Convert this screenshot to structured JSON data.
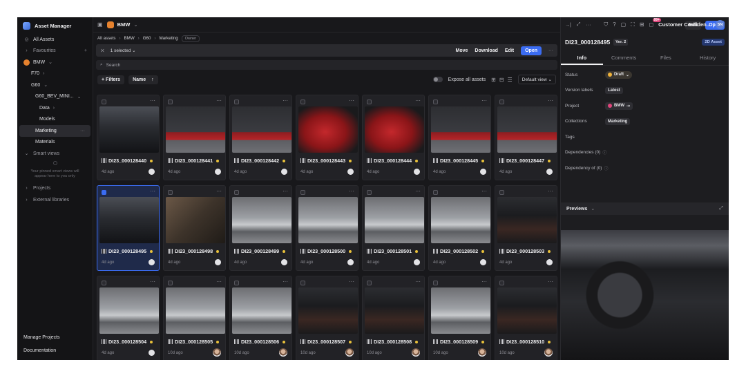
{
  "app": {
    "title": "Asset Manager"
  },
  "sidebar": {
    "items": [
      {
        "label": "All Assets"
      },
      {
        "label": "Favourites"
      },
      {
        "label": "BMW"
      },
      {
        "label": "F70"
      },
      {
        "label": "G60"
      },
      {
        "label": "G60_BEV_MINI..."
      },
      {
        "label": "Data"
      },
      {
        "label": "Models"
      },
      {
        "label": "Marketing"
      },
      {
        "label": "Materials"
      },
      {
        "label": "Smart views"
      },
      {
        "label": "Projects"
      },
      {
        "label": "External libraries"
      }
    ],
    "smart_hint": "Your pinned smart views will appear here to you only",
    "bottom": [
      {
        "label": "Manage Projects"
      },
      {
        "label": "Documentation"
      }
    ]
  },
  "header": {
    "workspace": "BMW",
    "notif_badge": "99+",
    "account": "Customer Confiden...",
    "avatar_initials": "SN"
  },
  "breadcrumb": [
    "All assets",
    "BMW",
    "G60",
    "Marketing"
  ],
  "owner_tag": "Owner",
  "selection": {
    "count": "1 selected",
    "actions": [
      "Move",
      "Download",
      "Edit"
    ],
    "open_label": "Open"
  },
  "search": {
    "placeholder": "Search"
  },
  "toolbar": {
    "filters": "Filters",
    "sort": "Name",
    "expose": "Expose all assets",
    "view": "Default view"
  },
  "assets": [
    {
      "name": "DI23_000128440",
      "age": "4d ago",
      "thumb": "t-int"
    },
    {
      "name": "DI23_000128441",
      "age": "4d ago",
      "thumb": "t-red"
    },
    {
      "name": "DI23_000128442",
      "age": "4d ago",
      "thumb": "t-red"
    },
    {
      "name": "DI23_000128443",
      "age": "4d ago",
      "thumb": "t-redclose"
    },
    {
      "name": "DI23_000128444",
      "age": "4d ago",
      "thumb": "t-redclose"
    },
    {
      "name": "DI23_000128445",
      "age": "4d ago",
      "thumb": "t-red"
    },
    {
      "name": "DI23_000128447",
      "age": "4d ago",
      "thumb": "t-red"
    },
    {
      "name": "DI23_000128495",
      "age": "4d ago",
      "thumb": "t-int",
      "selected": true
    },
    {
      "name": "DI23_000128498",
      "age": "4d ago",
      "thumb": "t-seat"
    },
    {
      "name": "DI23_000128499",
      "age": "4d ago",
      "thumb": "t-silver"
    },
    {
      "name": "DI23_000128500",
      "age": "4d ago",
      "thumb": "t-silver"
    },
    {
      "name": "DI23_000128501",
      "age": "4d ago",
      "thumb": "t-silver"
    },
    {
      "name": "DI23_000128502",
      "age": "4d ago",
      "thumb": "t-silver"
    },
    {
      "name": "DI23_000128503",
      "age": "4d ago",
      "thumb": "t-dark"
    },
    {
      "name": "DI23_000128504",
      "age": "4d ago",
      "thumb": "t-silver"
    },
    {
      "name": "DI23_000128505",
      "age": "10d ago",
      "thumb": "t-silver",
      "photo": true
    },
    {
      "name": "DI23_000128506",
      "age": "10d ago",
      "thumb": "t-silver",
      "photo": true
    },
    {
      "name": "DI23_000128507",
      "age": "10d ago",
      "thumb": "t-dark",
      "photo": true
    },
    {
      "name": "DI23_000128508",
      "age": "10d ago",
      "thumb": "t-dark",
      "photo": true
    },
    {
      "name": "DI23_000128509",
      "age": "10d ago",
      "thumb": "t-silver",
      "photo": true
    },
    {
      "name": "DI23_000128510",
      "age": "10d ago",
      "thumb": "t-dark",
      "photo": true
    }
  ],
  "panel": {
    "edit": "Edit",
    "open": "Open",
    "title": "DI23_000128495",
    "version": "Ver. 2",
    "type_badge": "2D Asset",
    "tabs": [
      "Info",
      "Comments",
      "Files",
      "History"
    ],
    "props": {
      "status_label": "Status",
      "status_value": "Draft",
      "version_labels_label": "Version labels",
      "version_labels_value": "Latest",
      "project_label": "Project",
      "project_value": "BMW",
      "collections_label": "Collections",
      "collections_value": "Marketing",
      "tags_label": "Tags",
      "dependencies_label": "Dependencies (0)",
      "dependency_of_label": "Dependency of (0)"
    },
    "previews": "Previews"
  },
  "colors": {
    "accent": "#3b6cf2",
    "workspace": "#e6822e",
    "draft": "#f0b33a"
  }
}
